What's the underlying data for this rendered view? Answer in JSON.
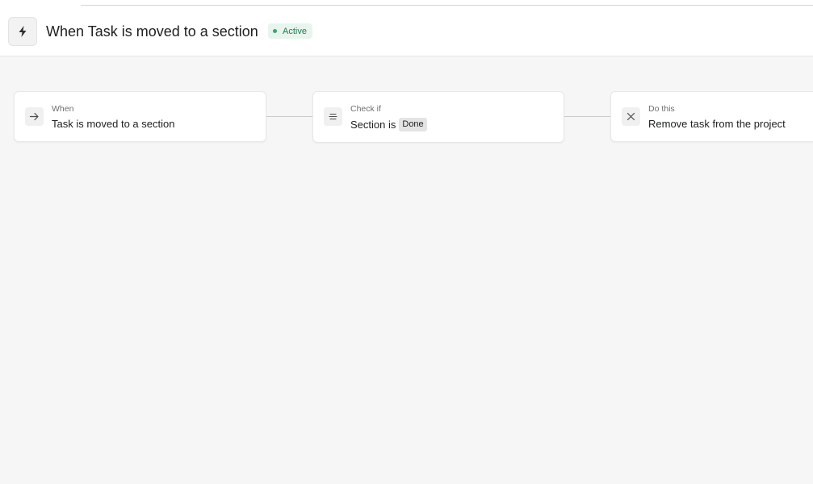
{
  "header": {
    "title": "When Task is moved to a section",
    "status": "Active",
    "icon": "lightning-icon"
  },
  "colors": {
    "status_bg": "#e8f5ee",
    "status_text": "#1f7a4d",
    "status_dot": "#37a86a",
    "canvas_bg": "#f6f6f6"
  },
  "steps": [
    {
      "kicker": "When",
      "description": "Task is moved to a section",
      "icon": "arrow-right-icon"
    },
    {
      "kicker": "Check if",
      "description": "Section is",
      "value": "Done",
      "icon": "equals-lines-icon"
    },
    {
      "kicker": "Do this",
      "description": "Remove task from the project",
      "icon": "close-x-icon"
    }
  ]
}
